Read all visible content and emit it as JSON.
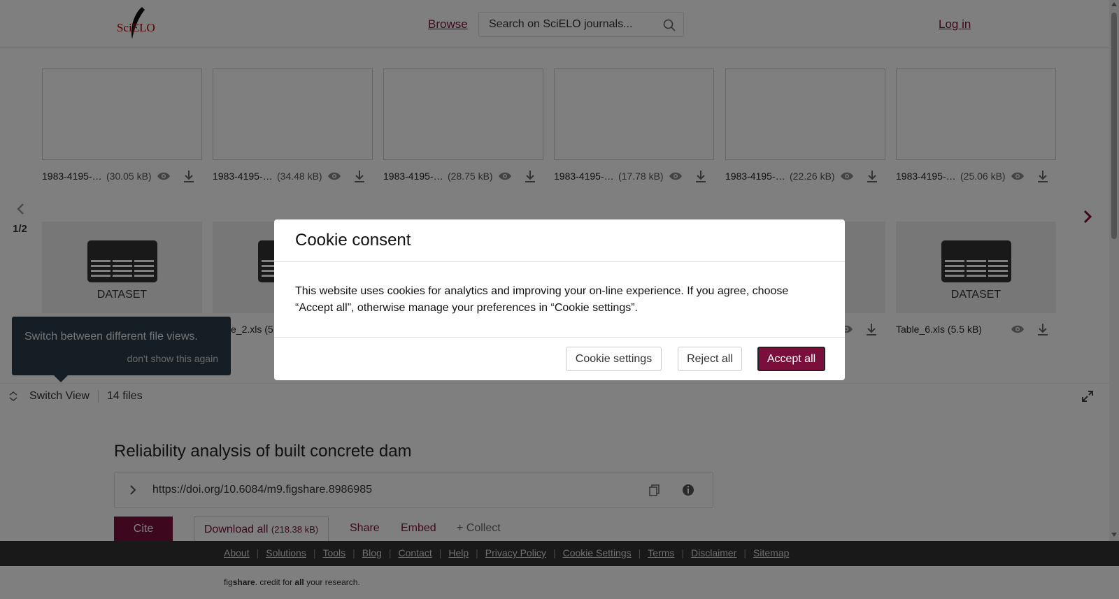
{
  "header": {
    "logo_text": "SciELO",
    "browse_label": "Browse",
    "search_placeholder": "Search on SciELO journals...",
    "login_label": "Log in"
  },
  "viewer": {
    "files_top": [
      {
        "name": "1983-4195-…",
        "size": "(30.05 kB)"
      },
      {
        "name": "1983-4195-…",
        "size": "(34.48 kB)"
      },
      {
        "name": "1983-4195-…",
        "size": "(28.75 kB)"
      },
      {
        "name": "1983-4195-…",
        "size": "(17.78 kB)"
      },
      {
        "name": "1983-4195-…",
        "size": "(22.26 kB)"
      },
      {
        "name": "1983-4195-…",
        "size": "(25.06 kB)"
      }
    ],
    "dataset_label": "DATASET",
    "partial_dataset_label": "D",
    "files_bottom_partial": "e_2.xls (5",
    "files_bottom_last": "Table_6.xls (5.5 kB)",
    "page_indicator": "1/2",
    "switch_view_label": "Switch View",
    "files_count": "14 files",
    "tooltip_text": "Switch between different file views.",
    "tooltip_link": "don't show this again"
  },
  "article": {
    "title": "Reliability analysis of built concrete dam",
    "doi": "https://doi.org/10.6084/m9.figshare.8986985",
    "cite_label": "Cite",
    "download_label": "Download all",
    "download_size": "(218.38 kB)",
    "share_label": "Share",
    "embed_label": "Embed",
    "collect_label": "+ Collect"
  },
  "footer": {
    "links": [
      "About",
      "Solutions",
      "Tools",
      "Blog",
      "Contact",
      "Help",
      "Privacy Policy",
      "Cookie Settings",
      "Terms",
      "Disclaimer",
      "Sitemap"
    ],
    "tagline_prefix": "fig",
    "tagline_brand": "share",
    "tagline_mid": ". credit for ",
    "tagline_all": "all",
    "tagline_suffix": " your research."
  },
  "cookie_modal": {
    "title": "Cookie consent",
    "body": "This website uses cookies for analytics and improving your on-line experience. If you agree, choose “Accept all”, otherwise manage your preferences in “Cookie settings”.",
    "settings_label": "Cookie settings",
    "reject_label": "Reject all",
    "accept_label": "Accept all"
  },
  "colors": {
    "brand": "#7a0f3c",
    "tooltip_bg": "#2c3d4a",
    "footer_bg": "#333333"
  },
  "icons": {
    "search": "search-icon",
    "preview": "eye-icon",
    "download": "download-icon",
    "prev": "chevron-left-icon",
    "next": "chevron-right-icon",
    "dataset": "table-icon",
    "switch": "switch-view-icon",
    "expand": "expand-icon",
    "copy": "copy-icon",
    "info": "info-icon",
    "doi_chevron": "chevron-right-icon"
  }
}
